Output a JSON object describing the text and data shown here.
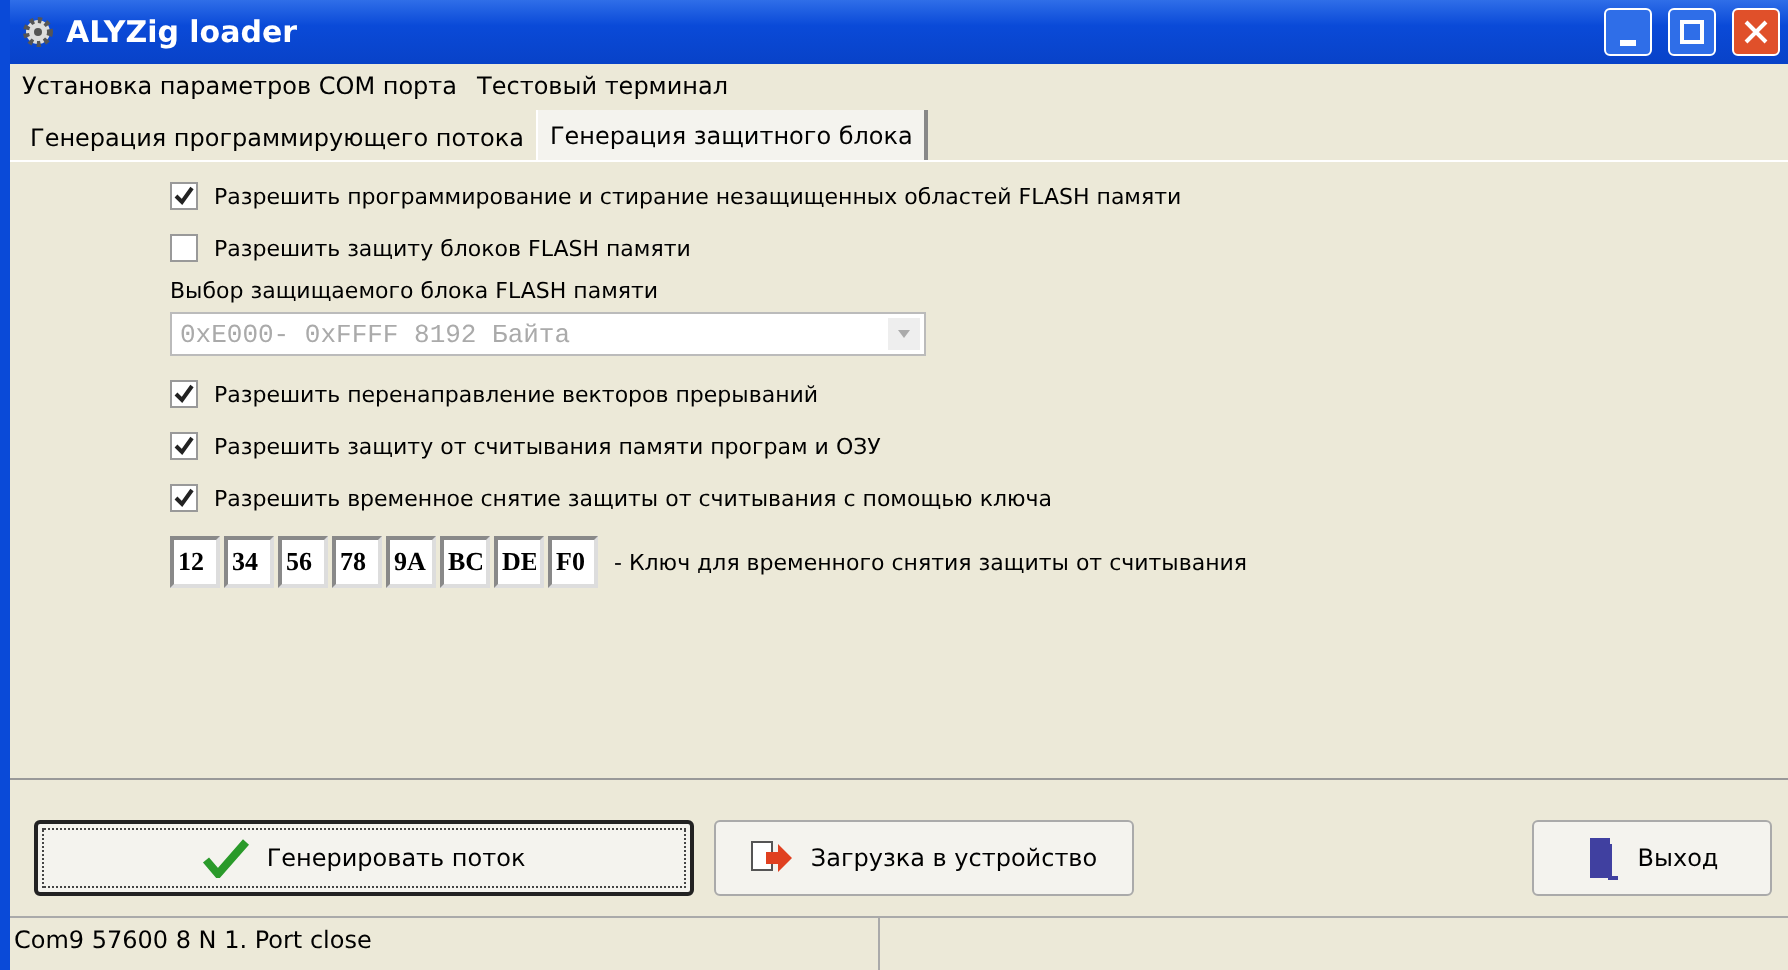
{
  "window": {
    "title": "ALYZig loader"
  },
  "menu": [
    "Установка параметров COM порта",
    "Тестовый терминал"
  ],
  "tabs": [
    {
      "label": "Генерация программирующего потока",
      "selected": false
    },
    {
      "label": "Генерация защитного блока",
      "selected": true
    }
  ],
  "options": [
    {
      "kind": "checkbox",
      "label": "Разрешить программирование и стирание незащищенных областей FLASH памяти",
      "checked": true
    },
    {
      "kind": "checkbox",
      "label": "Разрешить защиту блоков FLASH памяти",
      "checked": false
    },
    {
      "kind": "select",
      "label": "Выбор защищаемого блока FLASH памяти",
      "value": "0xE000- 0xFFFF 8192 Байта",
      "disabled": true
    },
    {
      "kind": "checkbox",
      "label": "Разрешить перенаправление векторов прерываний",
      "checked": true
    },
    {
      "kind": "checkbox",
      "label": "Разрешить защиту от считывания памяти програм и ОЗУ",
      "checked": true
    },
    {
      "kind": "checkbox",
      "label": "Разрешить временное снятие защиты от считывания с помощью ключа",
      "checked": true
    },
    {
      "kind": "key",
      "bytes": [
        "12",
        "34",
        "56",
        "78",
        "9A",
        "BC",
        "DE",
        "F0"
      ],
      "label": "- Ключ для временного снятия защиты от считывания"
    }
  ],
  "buttons": [
    {
      "kind": "generate",
      "label": "Генерировать поток",
      "focused": true
    },
    {
      "kind": "upload",
      "label": "Загрузка в устройство",
      "focused": false
    },
    {
      "kind": "exit",
      "label": "Выход",
      "focused": false
    }
  ],
  "status_bar": [
    "Com9 57600 8 N 1. Port close"
  ]
}
